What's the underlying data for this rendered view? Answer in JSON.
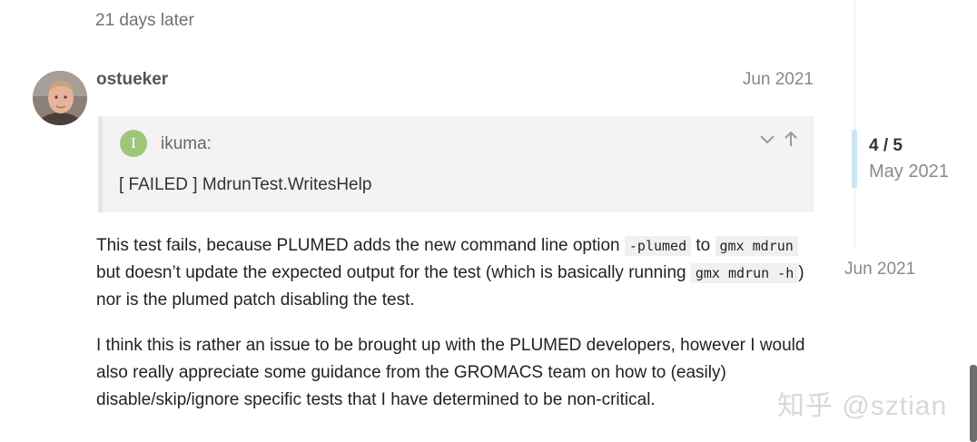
{
  "time_gap": "21 days later",
  "post": {
    "username": "ostueker",
    "date": "Jun 2021",
    "quote": {
      "avatar_letter": "I",
      "avatar_color": "#9ec57c",
      "user": "ikuma:",
      "text": "[ FAILED ] MdrunTest.WritesHelp"
    },
    "p1": {
      "t1": "This test fails, because PLUMED adds the new command line option ",
      "c1": "-plumed",
      "t2": " to ",
      "c2": "gmx mdrun",
      "t3": " but doesn’t update the expected output for the test (which is basically running ",
      "c3": "gmx mdrun -h",
      "t4": ") nor is the plumed patch disabling the test."
    },
    "p2": "I think this is rather an issue to be brought up with the PLUMED developers, however I would also really appreciate some guidance from the GROMACS team on how to (easily) disable/skip/ignore specific tests that I have determined to be non-critical."
  },
  "timeline": {
    "count": "4 / 5",
    "month": "May 2021",
    "end_date": "Jun 2021"
  },
  "watermark": "知乎 @sztian",
  "colors": {
    "accent_handle": "#c9e6f7",
    "quote_bg": "#f3f3f3"
  }
}
